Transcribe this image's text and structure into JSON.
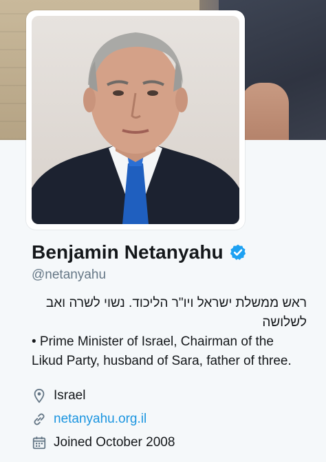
{
  "profile": {
    "display_name": "Benjamin Netanyahu",
    "handle": "@netanyahu",
    "verified_icon": "verified-badge-icon",
    "bio_hebrew": "ראש ממשלת ישראל ויו\"ר הליכוד. נשוי לשרה ואב לשלושה",
    "bio_english": " • Prime Minister of Israel, Chairman of the Likud Party, husband of Sara, father of three.",
    "location": "Israel",
    "website": "netanyahu.org.il",
    "joined": "Joined October 2008"
  },
  "icons": {
    "location": "location-pin-icon",
    "website": "link-icon",
    "joined": "calendar-icon"
  },
  "colors": {
    "accent": "#1b95e0",
    "verified": "#1da1f2",
    "text": "#14171a",
    "muted": "#657786",
    "background": "#f5f8fa"
  }
}
